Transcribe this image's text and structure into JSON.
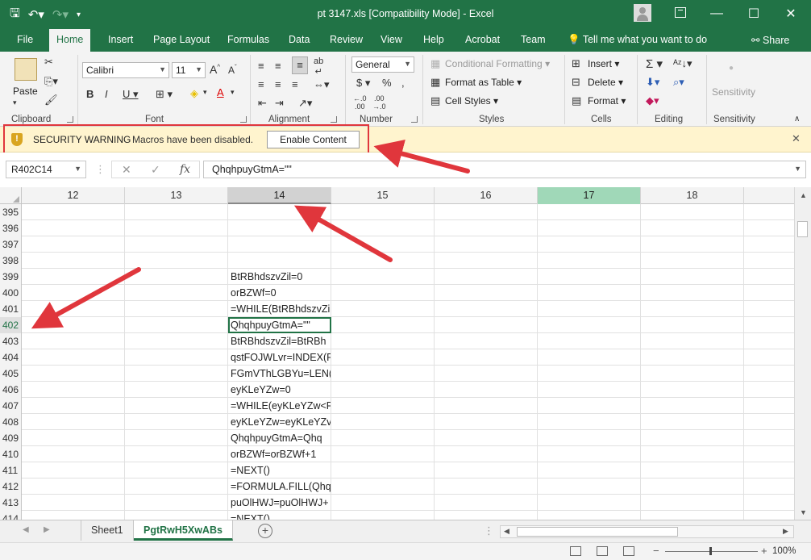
{
  "titlebar": {
    "title": "pt 3147.xls  [Compatibility Mode]  -  Excel",
    "save_icon": "save-icon",
    "undo_icon": "undo-icon",
    "redo_icon": "redo-icon"
  },
  "tabs": {
    "file": "File",
    "home": "Home",
    "insert": "Insert",
    "page_layout": "Page Layout",
    "formulas": "Formulas",
    "data": "Data",
    "review": "Review",
    "view": "View",
    "help": "Help",
    "acrobat": "Acrobat",
    "team": "Team",
    "tell_me": "Tell me what you want to do",
    "share": "Share"
  },
  "ribbon": {
    "clipboard": {
      "paste": "Paste",
      "label": "Clipboard"
    },
    "font": {
      "name": "Calibri",
      "size": "11",
      "label": "Font"
    },
    "alignment": {
      "label": "Alignment"
    },
    "number": {
      "format": "General",
      "label": "Number"
    },
    "styles": {
      "conditional_formatting": "Conditional Formatting",
      "format_as_table": "Format as Table",
      "cell_styles": "Cell Styles",
      "label": "Styles"
    },
    "cells": {
      "insert": "Insert",
      "delete": "Delete",
      "format": "Format",
      "label": "Cells"
    },
    "editing": {
      "label": "Editing"
    },
    "sensitivity": {
      "button": "Sensitivity",
      "label": "Sensitivity"
    }
  },
  "security_bar": {
    "title": "SECURITY WARNING",
    "message": "Macros have been disabled.",
    "enable_button": "Enable Content"
  },
  "formula_bar": {
    "name_box": "R402C14",
    "fx": "fx",
    "formula": "QhqhpuyGtmA=\"\""
  },
  "grid": {
    "columns": [
      "12",
      "13",
      "14",
      "15",
      "16",
      "17",
      "18"
    ],
    "active_column": "14",
    "highlighted_column": "17",
    "active_row": "402",
    "rows": [
      {
        "num": "395",
        "c14": ""
      },
      {
        "num": "396",
        "c14": ""
      },
      {
        "num": "397",
        "c14": ""
      },
      {
        "num": "398",
        "c14": ""
      },
      {
        "num": "399",
        "c14": "BtRBhdszvZil=0"
      },
      {
        "num": "400",
        "c14": "orBZWf=0"
      },
      {
        "num": "401",
        "c14": "=WHILE(BtRBhdszvZi"
      },
      {
        "num": "402",
        "c14": "QhqhpuyGtmA=\"\""
      },
      {
        "num": "403",
        "c14": "BtRBhdszvZil=BtRBh"
      },
      {
        "num": "404",
        "c14": "qstFOJWLvr=INDEX(F"
      },
      {
        "num": "405",
        "c14": "FGmVThLGBYu=LEN("
      },
      {
        "num": "406",
        "c14": "eyKLeYZw=0"
      },
      {
        "num": "407",
        "c14": "=WHILE(eyKLeYZw<F"
      },
      {
        "num": "408",
        "c14": "eyKLeYZw=eyKLeYZv"
      },
      {
        "num": "409",
        "c14": "QhqhpuyGtmA=Qhq"
      },
      {
        "num": "410",
        "c14": "orBZWf=orBZWf+1"
      },
      {
        "num": "411",
        "c14": "=NEXT()"
      },
      {
        "num": "412",
        "c14": "=FORMULA.FILL(Qhq"
      },
      {
        "num": "413",
        "c14": "puOlHWJ=puOlHWJ+"
      },
      {
        "num": "414",
        "c14": "=NEXT()"
      }
    ]
  },
  "sheets": {
    "tabs": [
      "Sheet1",
      "PgtRwH5XwABs"
    ],
    "active": "PgtRwH5XwABs"
  },
  "status": {
    "zoom": "100%"
  },
  "colors": {
    "accent": "#217346",
    "warning_bg": "#fff4ce",
    "annotation_red": "#e0363c"
  }
}
